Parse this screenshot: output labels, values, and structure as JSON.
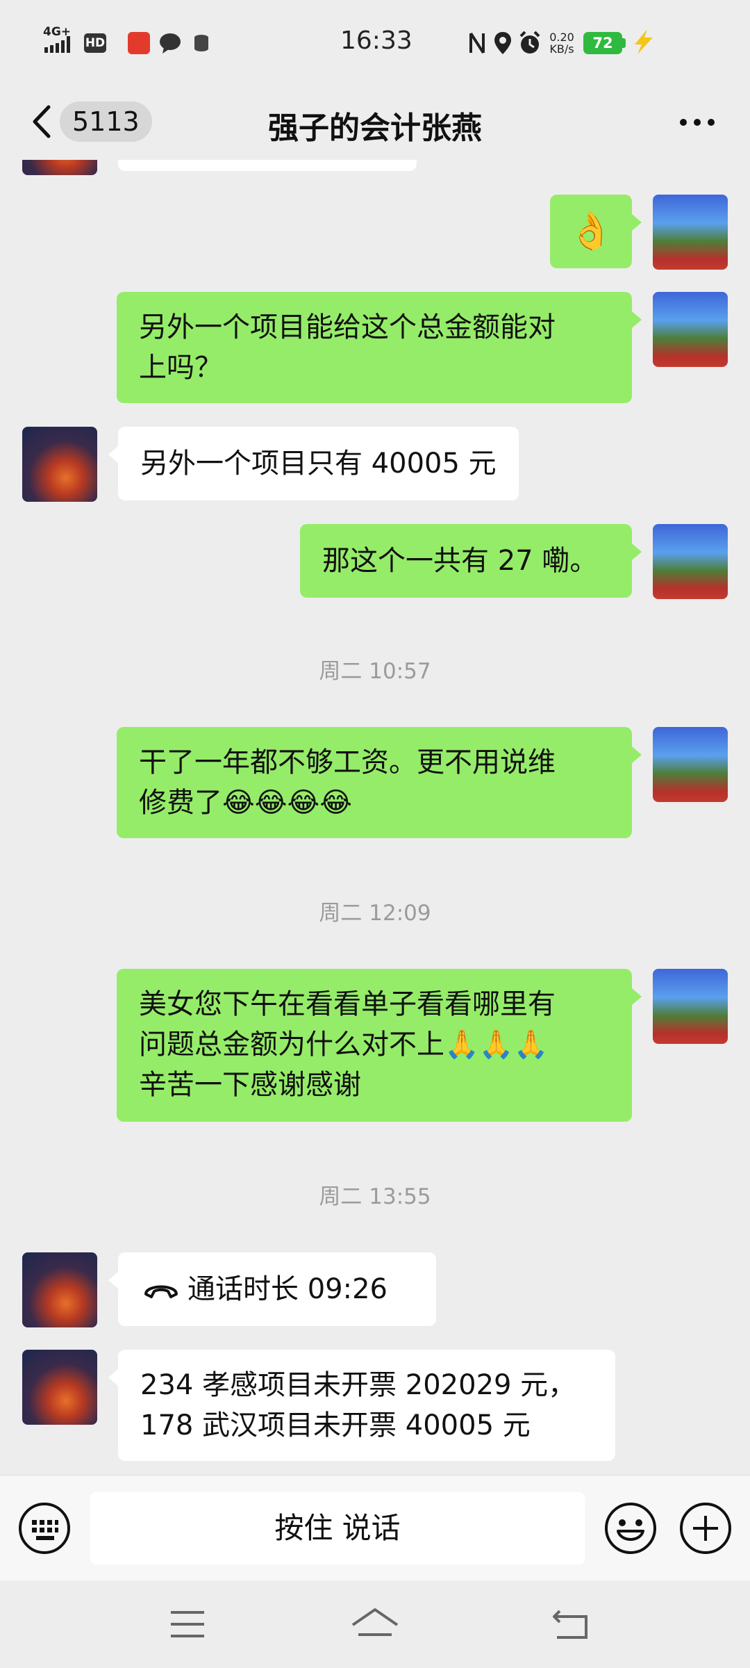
{
  "status_bar": {
    "time": "16:33",
    "network": "4G+",
    "hd": "HD",
    "speed_value": "0.20",
    "speed_unit": "KB/s",
    "battery": "72",
    "icons": [
      "signal-icon",
      "hd-icon",
      "app-notification-icon",
      "chat-icon",
      "storage-icon",
      "nfc-icon",
      "location-icon",
      "alarm-icon",
      "battery-icon",
      "charging-icon"
    ]
  },
  "nav": {
    "back_count": "5113",
    "title": "强子的会计张燕",
    "more_icon": "more-icon"
  },
  "messages": [
    {
      "side": "me",
      "type": "emoji",
      "text": "👌"
    },
    {
      "side": "me",
      "lines": [
        "另外一个项目能给这个总金额能对",
        "上吗？"
      ]
    },
    {
      "side": "them",
      "lines": [
        "另外一个项目只有 40005 元"
      ]
    },
    {
      "side": "me",
      "lines": [
        "那这个一共有 27 嘞。"
      ]
    },
    {
      "type": "time",
      "text": "周二 10:57"
    },
    {
      "side": "me",
      "lines": [
        "干了一年都不够工资。更不用说维",
        "修费了😂😂😂😂"
      ]
    },
    {
      "type": "time",
      "text": "周二 12:09"
    },
    {
      "side": "me",
      "lines": [
        "美女您下午在看看单子看看哪里有",
        "问题总金额为什么对不上🙏🙏🙏",
        "辛苦一下感谢感谢"
      ]
    },
    {
      "type": "time",
      "text": "周二 13:55"
    },
    {
      "side": "them",
      "type": "call",
      "lines": [
        "通话时长 09:26"
      ]
    },
    {
      "side": "them",
      "lines": [
        "234 孝感项目未开票 202029 元，",
        "178 武汉项目未开票 40005 元"
      ]
    }
  ],
  "input_bar": {
    "hold_to_talk": "按住 说话",
    "icons": [
      "keyboard-icon",
      "emoji-icon",
      "plus-icon"
    ]
  },
  "system_nav": {
    "icons": [
      "menu-icon",
      "home-icon",
      "back-icon"
    ]
  }
}
